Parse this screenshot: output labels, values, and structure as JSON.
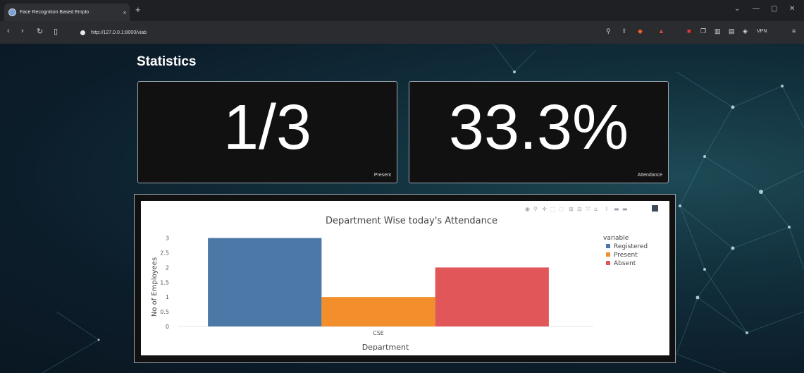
{
  "browser": {
    "tab_title": "Face Recognition Based Emplo",
    "tab_close": "×",
    "new_tab": "+",
    "url": "http://127.0.0.1:8000/viab",
    "vpn": "VPN"
  },
  "page": {
    "heading": "Statistics",
    "cards": [
      {
        "value": "1/3",
        "label": "Present"
      },
      {
        "value": "33.3%",
        "label": "Attendance"
      }
    ]
  },
  "colors": {
    "registered": "#4c78a8",
    "present": "#f28e2b",
    "absent": "#e15759"
  },
  "chart_data": {
    "type": "bar",
    "title": "Department Wise today's Attendance",
    "xlabel": "Department",
    "ylabel": "No of Employees",
    "categories": [
      "CSE"
    ],
    "series": [
      {
        "name": "Registered",
        "values": [
          3
        ]
      },
      {
        "name": "Present",
        "values": [
          1
        ]
      },
      {
        "name": "Absent",
        "values": [
          2
        ]
      }
    ],
    "ylim": [
      0,
      3.3
    ],
    "yticks": [
      "0",
      "0.5",
      "1",
      "1.5",
      "2",
      "2.5",
      "3"
    ],
    "legend_title": "variable",
    "legend_position": "top-right",
    "grid": false
  }
}
